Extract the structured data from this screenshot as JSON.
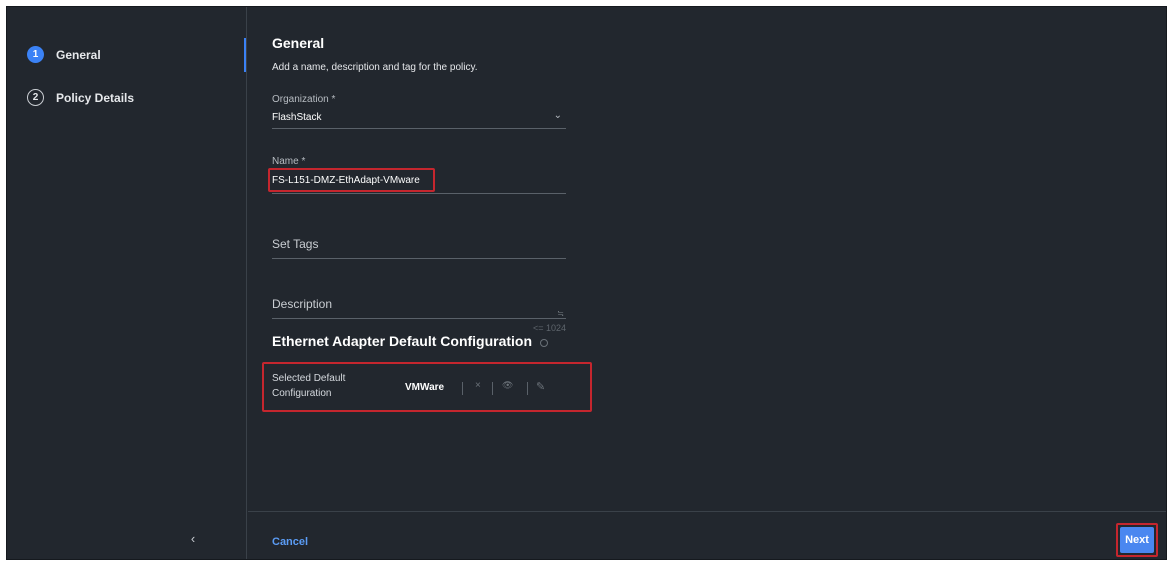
{
  "wizard": {
    "steps": [
      {
        "number": "1",
        "label": "General",
        "state": "active"
      },
      {
        "number": "2",
        "label": "Policy Details",
        "state": "inactive"
      }
    ],
    "collapse_icon": "chevron-left-icon"
  },
  "header": {
    "title": "General",
    "subtitle": "Add a name, description and tag for the policy."
  },
  "form": {
    "organization": {
      "label": "Organization *",
      "value": "FlashStack"
    },
    "name": {
      "label": "Name *",
      "value": "FS-L151-DMZ-EthAdapt-VMware"
    },
    "tags": {
      "placeholder": "Set Tags"
    },
    "description": {
      "placeholder": "Description",
      "counter": "<= 1024"
    }
  },
  "adapter_config": {
    "section_title": "Ethernet Adapter Default Configuration",
    "label_line1": "Selected Default",
    "label_line2": "Configuration",
    "selected_value": "VMWare",
    "actions": [
      {
        "icon": "close-icon",
        "glyph": "×"
      },
      {
        "icon": "eye-icon",
        "glyph": "👁"
      },
      {
        "icon": "pencil-icon",
        "glyph": "✎"
      }
    ]
  },
  "footer": {
    "cancel_label": "Cancel",
    "next_label": "Next"
  },
  "colors": {
    "background": "#22272e",
    "accent": "#3b82f6",
    "highlight": "#c5262e"
  }
}
